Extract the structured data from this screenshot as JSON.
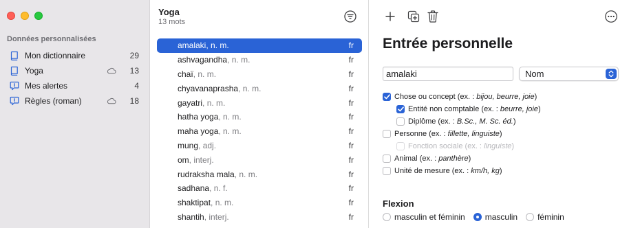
{
  "sidebar": {
    "section_title": "Données personnalisées",
    "items": [
      {
        "label": "Mon dictionnaire",
        "count": "29",
        "icon": "book-icon",
        "cloud": false
      },
      {
        "label": "Yoga",
        "count": "13",
        "icon": "book-icon",
        "cloud": true
      },
      {
        "label": "Mes alertes",
        "count": "4",
        "icon": "alert-bubble-icon",
        "cloud": false
      },
      {
        "label": "Règles (roman)",
        "count": "18",
        "icon": "alert-bubble-icon",
        "cloud": true
      }
    ]
  },
  "list": {
    "title": "Yoga",
    "subtitle": "13 mots",
    "words": [
      {
        "word": "amalaki",
        "category": ", n. m.",
        "lang": "fr",
        "selected": true
      },
      {
        "word": "ashvagandha",
        "category": ", n. m.",
        "lang": "fr",
        "selected": false
      },
      {
        "word": "chaï",
        "category": ", n. m.",
        "lang": "fr",
        "selected": false
      },
      {
        "word": "chyavanaprasha",
        "category": ", n. m.",
        "lang": "fr",
        "selected": false
      },
      {
        "word": "gayatri",
        "category": ", n. m.",
        "lang": "fr",
        "selected": false
      },
      {
        "word": "hatha yoga",
        "category": ", n. m.",
        "lang": "fr",
        "selected": false
      },
      {
        "word": "maha yoga",
        "category": ", n. m.",
        "lang": "fr",
        "selected": false
      },
      {
        "word": "mung",
        "category": ", adj.",
        "lang": "fr",
        "selected": false
      },
      {
        "word": "om",
        "category": ", interj.",
        "lang": "fr",
        "selected": false
      },
      {
        "word": "rudraksha mala",
        "category": ", n. m.",
        "lang": "fr",
        "selected": false
      },
      {
        "word": "sadhana",
        "category": ", n. f.",
        "lang": "fr",
        "selected": false
      },
      {
        "word": "shaktipat",
        "category": ", n. m.",
        "lang": "fr",
        "selected": false
      },
      {
        "word": "shantih",
        "category": ", interj.",
        "lang": "fr",
        "selected": false
      }
    ]
  },
  "toolbar": {
    "buttons": [
      "plus-icon",
      "duplicate-icon",
      "trash-icon",
      "more-icon"
    ]
  },
  "detail": {
    "title": "Entrée personnelle",
    "word_value": "amalaki",
    "pos_value": "Nom",
    "checks": [
      {
        "label": "Chose ou concept (ex. : ",
        "examples": "bijou, beurre, joie",
        "suffix": ")",
        "checked": true,
        "indent": 0,
        "disabled": false,
        "name": "chose-ou-concept"
      },
      {
        "label": "Entité non comptable (ex. : ",
        "examples": "beurre, joie",
        "suffix": ")",
        "checked": true,
        "indent": 1,
        "disabled": false,
        "name": "entite-non-comptable"
      },
      {
        "label": "Diplôme (ex. : ",
        "examples": "B.Sc., M. Sc. éd.",
        "suffix": ")",
        "checked": false,
        "indent": 1,
        "disabled": false,
        "name": "diplome"
      },
      {
        "label": "Personne (ex. : ",
        "examples": "fillette, linguiste",
        "suffix": ")",
        "checked": false,
        "indent": 0,
        "disabled": false,
        "name": "personne"
      },
      {
        "label": "Fonction sociale (ex. : ",
        "examples": "linguiste",
        "suffix": ")",
        "checked": false,
        "indent": 1,
        "disabled": true,
        "name": "fonction-sociale"
      },
      {
        "label": "Animal (ex. : ",
        "examples": "panthère",
        "suffix": ")",
        "checked": false,
        "indent": 0,
        "disabled": false,
        "name": "animal"
      },
      {
        "label": "Unité de mesure (ex. : ",
        "examples": "km/h, kg",
        "suffix": ")",
        "checked": false,
        "indent": 0,
        "disabled": false,
        "name": "unite-de-mesure"
      }
    ],
    "flexion_title": "Flexion",
    "radios": [
      {
        "label": "masculin et féminin",
        "selected": false
      },
      {
        "label": "masculin",
        "selected": true
      },
      {
        "label": "féminin",
        "selected": false
      }
    ]
  },
  "colors": {
    "accent": "#2a63d6",
    "sidebar_bg": "#e8e6e9"
  }
}
